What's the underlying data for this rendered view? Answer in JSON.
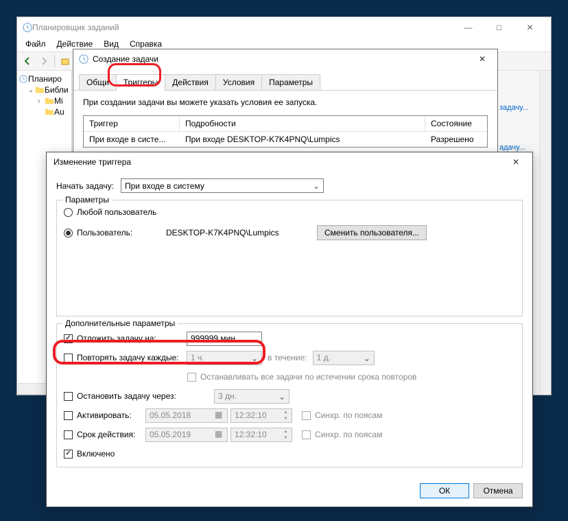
{
  "main": {
    "title": "Планировщик заданий",
    "menubar": {
      "file": "Файл",
      "action": "Действие",
      "view": "Вид",
      "help": "Справка"
    },
    "tree": {
      "root": "Планиро",
      "lib": "Библи",
      "mic": "Mi",
      "ad": "Au"
    },
    "right": {
      "link1": "задачу...",
      "link2": "адачу..."
    }
  },
  "create": {
    "title": "Создание задачи",
    "tabs": {
      "general": "Общи",
      "triggers": "Триггеры",
      "actions": "Действия",
      "conditions": "Условия",
      "settings": "Параметры"
    },
    "desc": "При создании задачи вы можете указать условия ее запуска.",
    "table": {
      "h_trigger": "Триггер",
      "h_details": "Подробности",
      "h_status": "Состояние",
      "r_trigger": "При входе в систе...",
      "r_details": "При входе DESKTOP-K7K4PNQ\\Lumpics",
      "r_status": "Разрешено"
    }
  },
  "edit": {
    "title": "Изменение триггера",
    "begin_label": "Начать задачу:",
    "begin_value": "При входе в систему",
    "params_legend": "Параметры",
    "opt_any_user": "Любой пользователь",
    "opt_user": "Пользователь:",
    "user_value": "DESKTOP-K7K4PNQ\\Lumpics",
    "change_user": "Сменить пользователя...",
    "adv_legend": "Дополнительные параметры",
    "delay_label": "Отложить задачу на:",
    "delay_value": "999999 мин.",
    "repeat_label": "Повторять задачу каждые:",
    "repeat_value": "1 ч.",
    "duration_label": "в течение:",
    "duration_value": "1 д.",
    "stop_all": "Останавливать все задачи по истечении срока повторов",
    "stop_after": "Остановить задачу через:",
    "stop_value": "3 дн.",
    "activate": "Активировать:",
    "activate_date": "05.05.2018",
    "activate_time": "12:32:10",
    "expire": "Срок действия:",
    "expire_date": "05.05.2019",
    "expire_time": "12:32:10",
    "sync_tz": "Синхр. по поясам",
    "enabled": "Включено",
    "ok": "ОК",
    "cancel": "Отмена"
  }
}
